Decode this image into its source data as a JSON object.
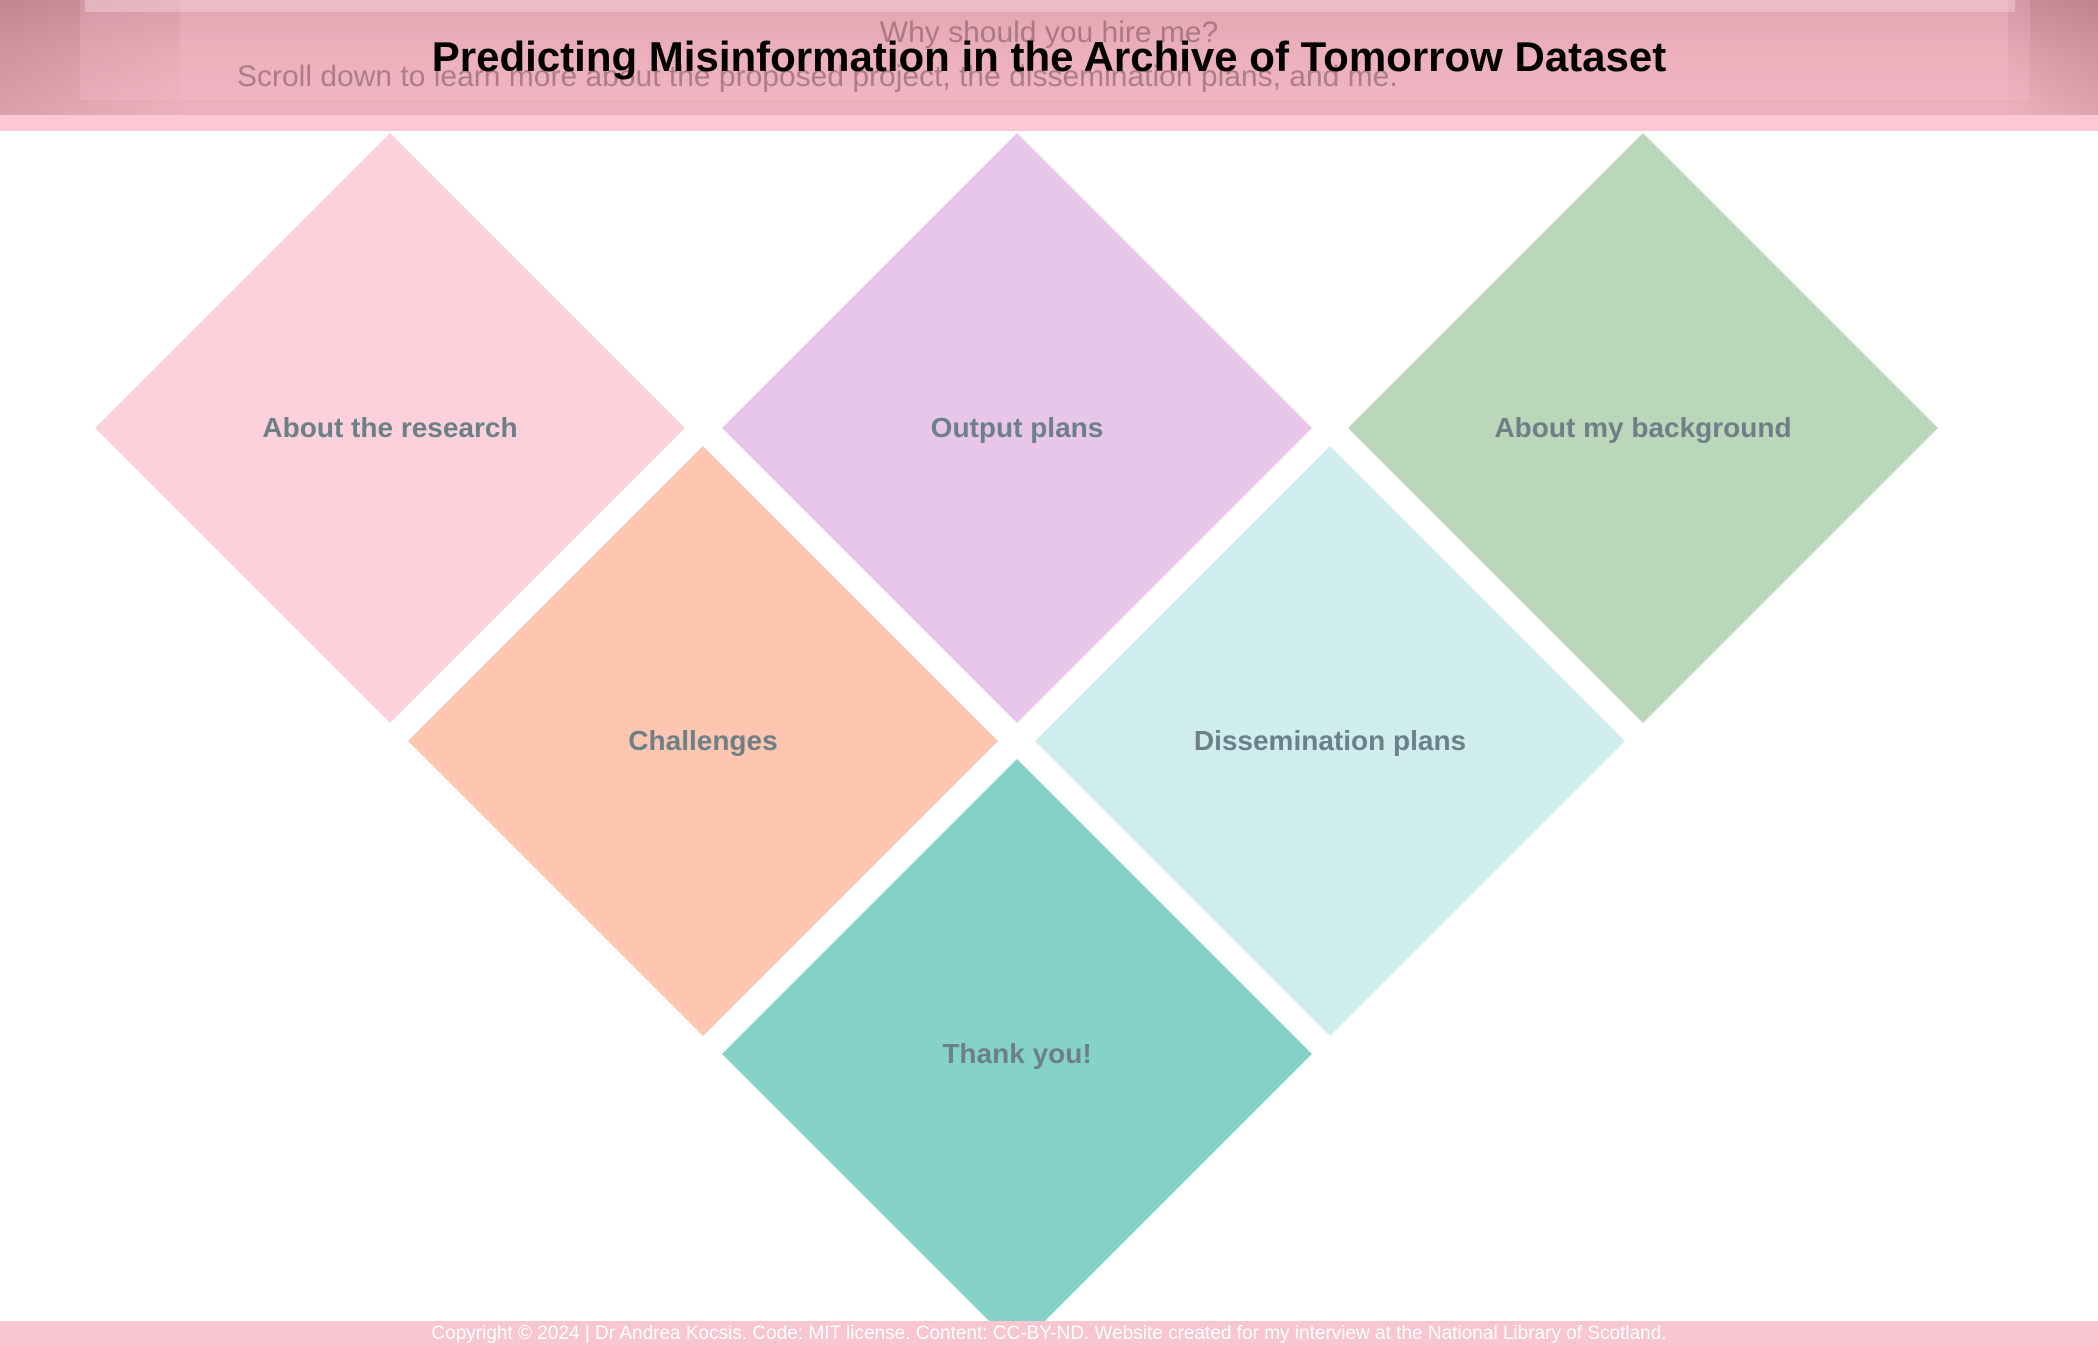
{
  "header": {
    "title": "Predicting Misinformation in the Archive of Tomorrow Dataset",
    "ghost_question": "Why should you hire me?",
    "ghost_intro": "Scroll down to learn more about the proposed project, the dissemination plans, and me."
  },
  "menu": {
    "items": [
      {
        "label": "About the research",
        "color": "#fdd1dc"
      },
      {
        "label": "Output plans",
        "color": "#e8c6ea"
      },
      {
        "label": "About my background",
        "color": "#bad8b9"
      },
      {
        "label": "Challenges",
        "color": "#fec5b0"
      },
      {
        "label": "Dissemination plans",
        "color": "#cfecef"
      },
      {
        "label": "Thank you!",
        "color": "#85d2c9"
      }
    ]
  },
  "footer": {
    "text": "Copyright © 2024 | Dr Andrea Kocsis. Code: MIT license. Content: CC-BY-ND. Website created for my interview at the National Library of Scotland."
  },
  "colors": {
    "header_pink": "#f0b3c1",
    "header_strip": "#fdc7d3",
    "label_text": "#6d8088",
    "footer_bg": "#f7c6d0"
  }
}
